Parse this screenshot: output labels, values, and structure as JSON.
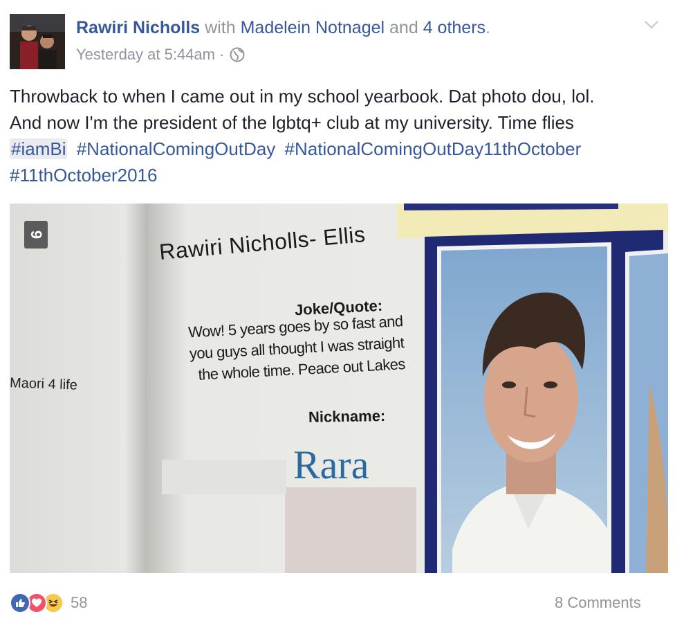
{
  "header": {
    "author": "Rawiri Nicholls",
    "with_word": "with",
    "tagged": "Madelein Notnagel",
    "and_word": "and",
    "others": "4 others",
    "period": ".",
    "timestamp": "Yesterday at 5:44am",
    "separator": "·",
    "privacy_icon": "globe-icon",
    "menu_icon": "chevron-down-icon"
  },
  "post": {
    "text_line1": "Throwback to when I came out in my school yearbook. Dat photo dou, lol.",
    "text_line2": "And now I'm the president of the lgbtq+ club at my university. Time flies",
    "hashtags": [
      "#iamBi",
      "#NationalComingOutDay",
      "#NationalComingOutDay11thOctober",
      "#11thOctober2016"
    ]
  },
  "photo": {
    "page_number": "9",
    "name": "Rawiri Nicholls- Ellis",
    "joke_label": "Joke/Quote:",
    "quote": "Wow! 5 years goes by so fast and you guys all thought I was straight the whole time. Peace out Lakes",
    "nickname_label": "Nickname:",
    "nickname": "Rara",
    "left_page_text": "Maori 4 life"
  },
  "footer": {
    "reaction_icons": [
      "like-icon",
      "love-icon",
      "haha-icon"
    ],
    "reaction_count": "58",
    "comments": "8 Comments"
  },
  "colors": {
    "link": "#365899",
    "muted": "#90949c",
    "text": "#1d2129",
    "like": "#4267b2",
    "love": "#f25268",
    "haha": "#f7c84b"
  }
}
